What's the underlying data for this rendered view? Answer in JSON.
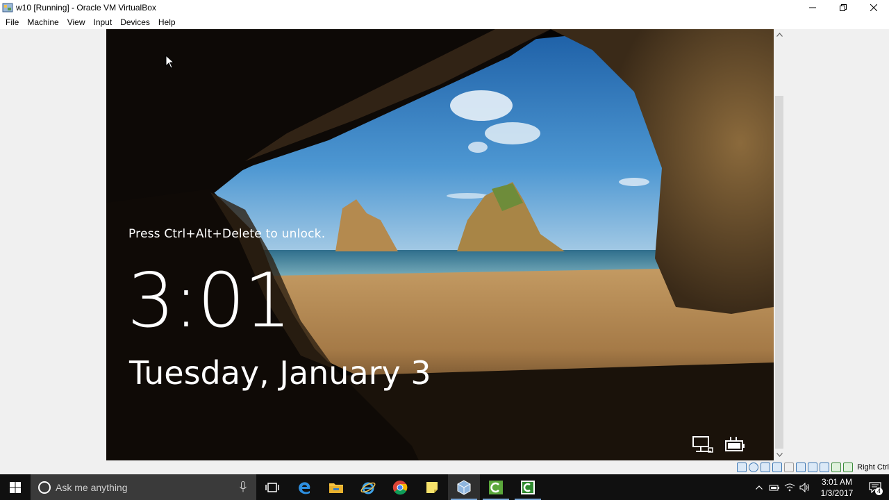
{
  "window": {
    "title": "w10 [Running] - Oracle VM VirtualBox",
    "controls": [
      "minimize-icon",
      "restore-icon",
      "close-icon"
    ]
  },
  "menu": [
    "File",
    "Machine",
    "View",
    "Input",
    "Devices",
    "Help"
  ],
  "lockscreen": {
    "message": "Press Ctrl+Alt+Delete to unlock.",
    "time": "3:01",
    "date": "Tuesday, January 3",
    "icons": [
      "network-icon",
      "battery-icon"
    ]
  },
  "statusbar": {
    "host_key": "Right Ctrl",
    "icons": [
      "hard-disk-icon",
      "optical-drive-icon",
      "audio-icon",
      "network-icon",
      "usb-icon",
      "shared-folders-icon",
      "display-icon",
      "video-capture-icon",
      "cpu-icon",
      "mouse-integration-icon"
    ]
  },
  "taskbar": {
    "search_placeholder": "Ask me anything",
    "apps": [
      "task-view-icon",
      "edge-icon",
      "file-explorer-icon",
      "internet-explorer-icon",
      "chrome-icon",
      "sticky-notes-icon",
      "virtualbox-icon",
      "camtasia-icon",
      "camtasia-recorder-icon"
    ],
    "clock_time": "3:01 AM",
    "clock_date": "1/3/2017",
    "notification_count": "4"
  },
  "colors": {
    "taskbar": "#101010",
    "search": "#3a3a3a",
    "accent": "#7aa7d8",
    "sky": "#3f86c7",
    "sand": "#b88a52"
  }
}
